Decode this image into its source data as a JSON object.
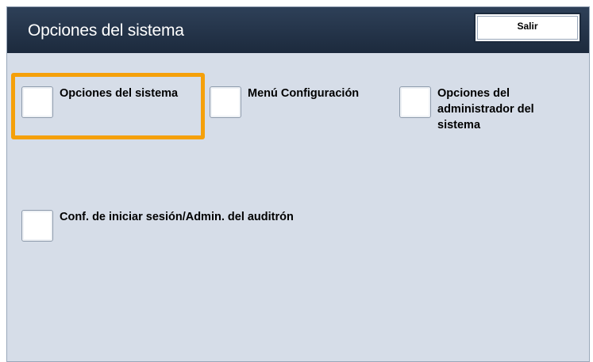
{
  "header": {
    "title": "Opciones del sistema",
    "exit_label": "Salir"
  },
  "options": [
    {
      "label": "Opciones del sistema",
      "selected": true
    },
    {
      "label": "Menú Configuración",
      "selected": false
    },
    {
      "label": "Opciones del administrador del sistema",
      "selected": false
    },
    {
      "label": "Conf. de iniciar sesión/Admin. del auditrón",
      "selected": false
    }
  ],
  "colors": {
    "titlebar": "#1c2a3d",
    "panel": "#d6dde8",
    "highlight": "#f5a00a"
  }
}
